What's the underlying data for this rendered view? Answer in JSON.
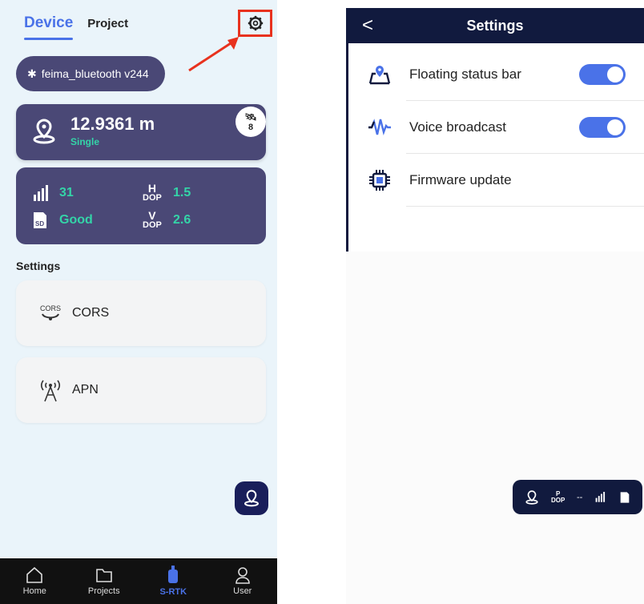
{
  "left": {
    "tabs": {
      "device": "Device",
      "project": "Project"
    },
    "bluetooth_label": "feima_bluetooth v244",
    "position": {
      "distance": "12.9361 m",
      "mode": "Single",
      "satellites": "8"
    },
    "stats": {
      "sim_value": "31",
      "sd_value": "Good",
      "h_label": "H",
      "v_label": "V",
      "dop_label": "DOP",
      "hdop": "1.5",
      "vdop": "2.6"
    },
    "settings_title": "Settings",
    "items": [
      {
        "label": "CORS",
        "icon_text": "CORS"
      },
      {
        "label": "APN"
      }
    ],
    "nav": [
      {
        "label": "Home"
      },
      {
        "label": "Projects"
      },
      {
        "label": "S-RTK"
      },
      {
        "label": "User"
      }
    ],
    "colors": {
      "accent": "#4a72e8",
      "card": "#4a4876",
      "good": "#34d4a8",
      "highlight": "#e8321e"
    }
  },
  "right": {
    "header": {
      "title": "Settings",
      "back": "<"
    },
    "rows": [
      {
        "label": "Floating status bar",
        "toggle": true
      },
      {
        "label": "Voice broadcast",
        "toggle": true
      },
      {
        "label": "Firmware update"
      }
    ],
    "status_bar": {
      "p_label": "P",
      "dop_label": "DOP",
      "dop_value": "--",
      "sim_label": "SIM",
      "sd_label": "SD"
    }
  }
}
